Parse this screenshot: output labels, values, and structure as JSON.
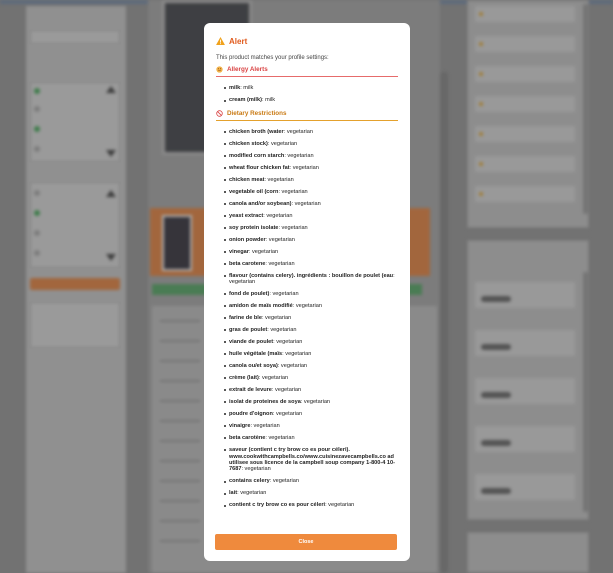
{
  "modal": {
    "title": "Alert",
    "subtitle": "This product matches your profile settings:",
    "allergy_title": "Allergy Alerts",
    "allergies": [
      {
        "name": "milk",
        "detail": ": milk"
      },
      {
        "name": "cream (milk)",
        "detail": ": milk"
      }
    ],
    "diet_title": "Dietary Restrictions",
    "dietary": [
      {
        "name": "chicken broth (water",
        "detail": ": vegetarian"
      },
      {
        "name": "chicken stock)",
        "detail": ": vegetarian"
      },
      {
        "name": "modified corn starch",
        "detail": ": vegetarian"
      },
      {
        "name": "wheat flour chicken fat",
        "detail": ": vegetarian"
      },
      {
        "name": "chicken meat",
        "detail": ": vegetarian"
      },
      {
        "name": "vegetable oil (corn",
        "detail": ": vegetarian"
      },
      {
        "name": "canola and/or soybean)",
        "detail": ": vegetarian"
      },
      {
        "name": "yeast extract",
        "detail": ": vegetarian"
      },
      {
        "name": "soy protein isolate",
        "detail": ": vegetarian"
      },
      {
        "name": "onion powder",
        "detail": ": vegetarian"
      },
      {
        "name": "vinegar",
        "detail": ": vegetarian"
      },
      {
        "name": "beta carotene",
        "detail": ": vegetarian"
      },
      {
        "name": "flavour (contains celery). ingrédients : bouillon de poulet (eau",
        "detail": ": vegetarian"
      },
      {
        "name": "fond de poulet)",
        "detail": ": vegetarian"
      },
      {
        "name": "amidon de maïs modifié",
        "detail": ": vegetarian"
      },
      {
        "name": "farine de ble",
        "detail": ": vegetarian"
      },
      {
        "name": "gras de poulet",
        "detail": ": vegetarian"
      },
      {
        "name": "viande de poulet",
        "detail": ": vegetarian"
      },
      {
        "name": "huile végétale (maïs",
        "detail": ": vegetarian"
      },
      {
        "name": "canola ou/et soya)",
        "detail": ": vegetarian"
      },
      {
        "name": "crème (lait)",
        "detail": ": vegetarian"
      },
      {
        "name": "extrait de levure",
        "detail": ": vegetarian"
      },
      {
        "name": "isolat de proteines de soya",
        "detail": ": vegetarian"
      },
      {
        "name": "poudre d'oignon",
        "detail": ": vegetarian"
      },
      {
        "name": "vinaigre",
        "detail": ": vegetarian"
      },
      {
        "name": "beta carotène",
        "detail": ": vegetarian"
      },
      {
        "name": "saveur (contient c try brow co es pour céleri). www.cookwithcampbells.co/www.cuisinezavecampbells.co ad utilisee sous licence de la campbell soup company 1-800-4 10-7687",
        "detail": ": vegetarian"
      },
      {
        "name": "contains celery",
        "detail": ": vegetarian"
      },
      {
        "name": "lait",
        "detail": ": vegetarian"
      },
      {
        "name": "contient c try brow co es pour céleri",
        "detail": ": vegetarian"
      }
    ],
    "close_label": "Close"
  },
  "colors": {
    "accent": "#ef8a3d",
    "title": "#e05a1c",
    "allergy": "#d94343",
    "diet": "#c97a14"
  },
  "icons": {
    "title": "warning-icon",
    "allergy": "allergy-icon",
    "diet": "prohibited-icon"
  }
}
